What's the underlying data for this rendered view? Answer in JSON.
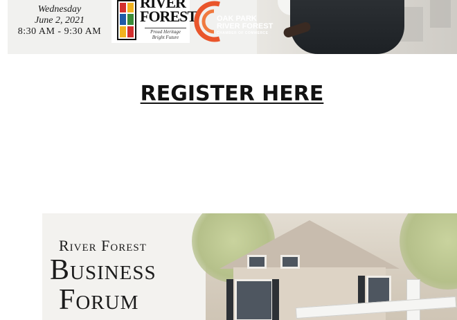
{
  "top_banner": {
    "date": {
      "weekday": "Wednesday",
      "day": "June 2, 2021",
      "time": "8:30 AM - 9:30 AM"
    },
    "river_forest_logo": {
      "name_line1": "RIVER",
      "name_line2": "FOREST",
      "tag_line1": "Proud Heritage",
      "tag_line2": "Bright Future"
    },
    "chamber_logo": {
      "line1": "OAK PARK",
      "line2": "RIVER FOREST",
      "line3": "CHAMBER OF COMMERCE",
      "accent_color": "#e9552b"
    }
  },
  "register": {
    "label": "REGISTER HERE"
  },
  "bottom_banner": {
    "line1": "River Forest",
    "line2": "Business",
    "line3": "Forum"
  }
}
